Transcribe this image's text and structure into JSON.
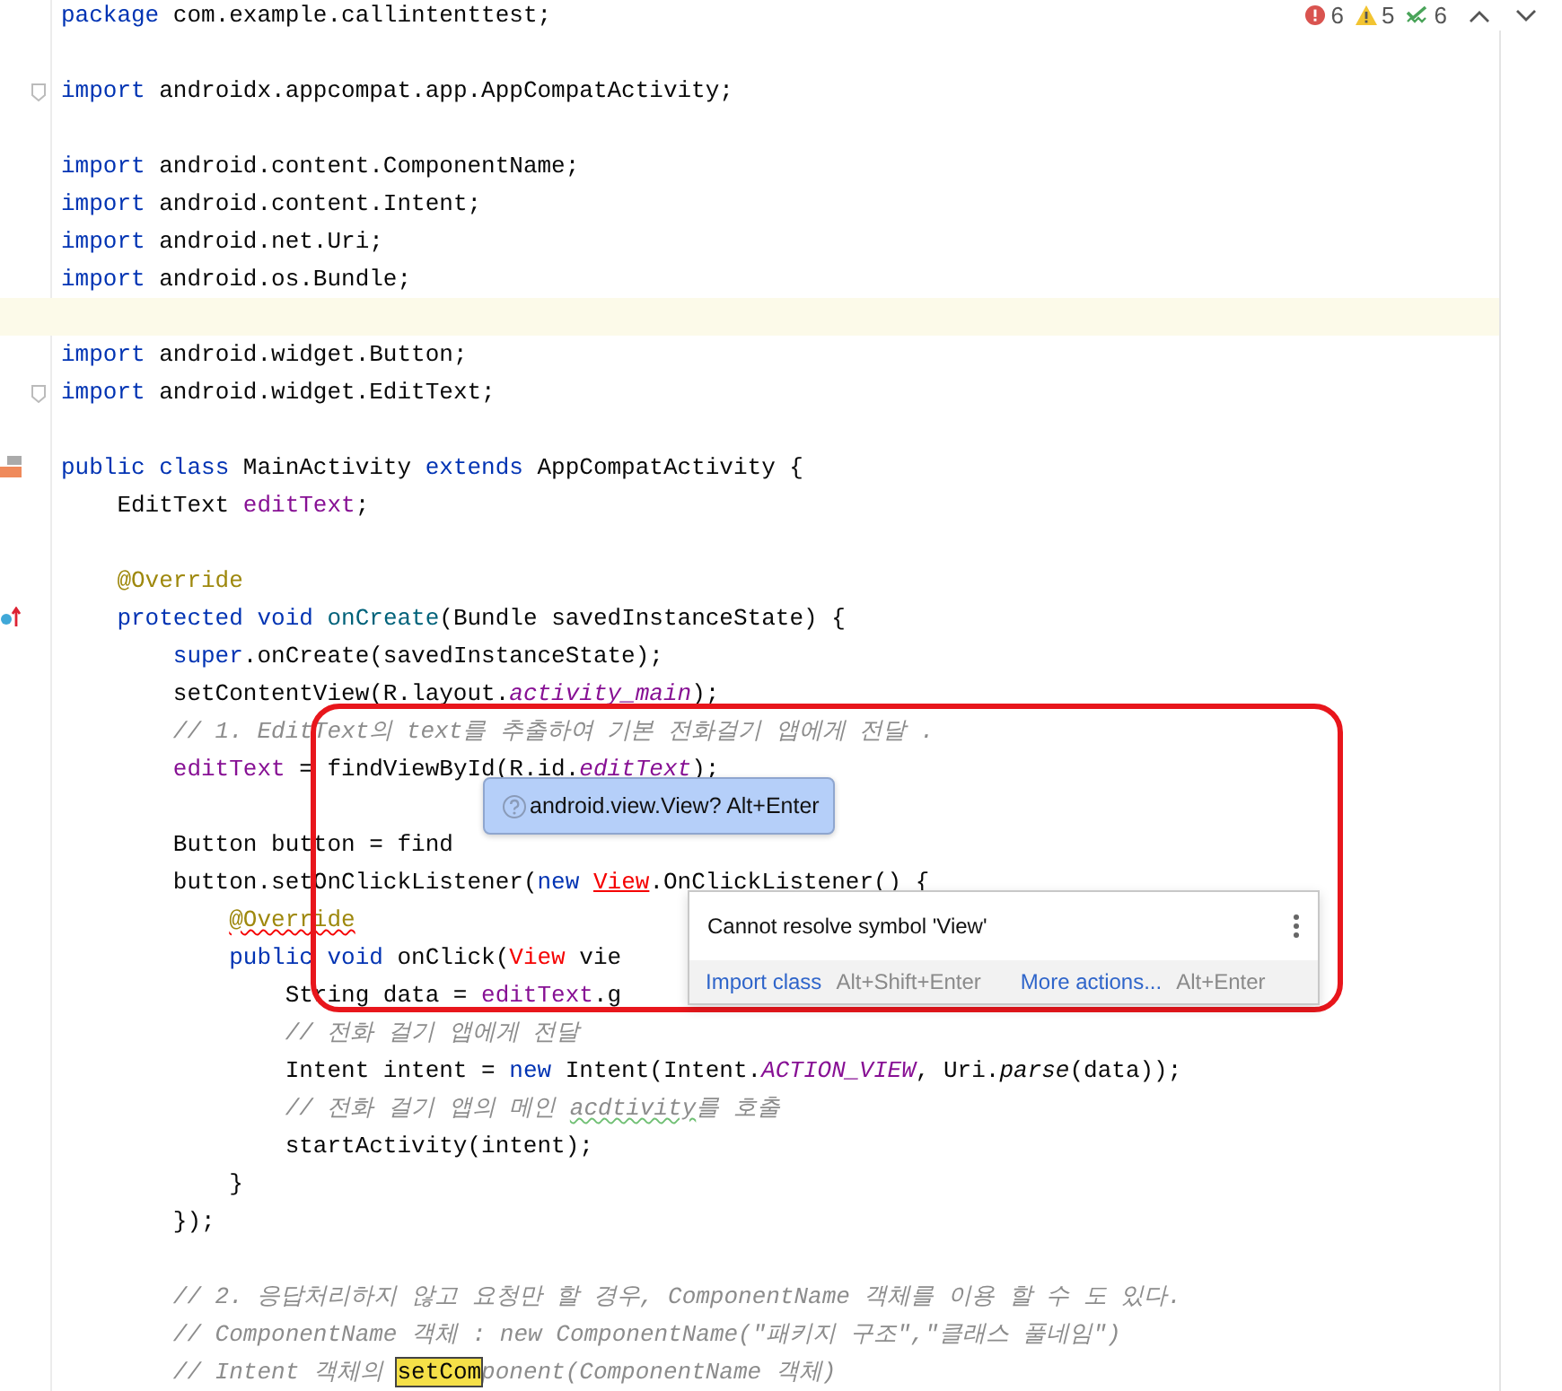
{
  "inspections": [
    {
      "kind": "error",
      "count": "6"
    },
    {
      "kind": "warning",
      "count": "5"
    },
    {
      "kind": "typo",
      "count": "6"
    }
  ],
  "lines": [
    {
      "current": false,
      "tokens": [
        {
          "kind": "kw",
          "text": "package"
        },
        {
          "kind": "plain",
          "text": " com.example.callintenttest;"
        }
      ]
    },
    {
      "current": false
    },
    {
      "kind": "fold",
      "current": false,
      "tokens": [
        {
          "kind": "kw",
          "text": "import"
        },
        {
          "kind": "plain",
          "text": " androidx.appcompat.app.AppCompatActivity;"
        }
      ]
    },
    {
      "current": false
    },
    {
      "current": false,
      "tokens": [
        {
          "kind": "kw",
          "text": "import"
        },
        {
          "kind": "plain",
          "text": " android.content.ComponentName;"
        }
      ]
    },
    {
      "current": false,
      "tokens": [
        {
          "kind": "kw",
          "text": "import"
        },
        {
          "kind": "plain",
          "text": " android.content.Intent;"
        }
      ]
    },
    {
      "current": false,
      "tokens": [
        {
          "kind": "kw",
          "text": "import"
        },
        {
          "kind": "plain",
          "text": " android.net.Uri;"
        }
      ]
    },
    {
      "current": false,
      "tokens": [
        {
          "kind": "kw",
          "text": "import"
        },
        {
          "kind": "plain",
          "text": " android.os.Bundle;"
        }
      ]
    },
    {
      "current": true
    },
    {
      "current": false,
      "tokens": [
        {
          "kind": "kw",
          "text": "import"
        },
        {
          "kind": "plain",
          "text": " android.widget.Button;"
        }
      ]
    },
    {
      "kind": "fold",
      "current": false,
      "tokens": [
        {
          "kind": "kw",
          "text": "import"
        },
        {
          "kind": "plain",
          "text": " android.widget.EditText;"
        }
      ]
    },
    {
      "current": false
    },
    {
      "kind": "class",
      "current": false,
      "tokens": [
        {
          "kind": "kw",
          "text": "public class"
        },
        {
          "kind": "plain",
          "text": " MainActivity "
        },
        {
          "kind": "kw",
          "text": "extends"
        },
        {
          "kind": "plain",
          "text": " AppCompatActivity {"
        }
      ],
      "children": [
        {
          "current": false,
          "tokens": [
            {
              "kind": "plain",
              "text": "EditText "
            },
            {
              "kind": "field",
              "text": "editText"
            },
            {
              "kind": "plain",
              "text": ";"
            }
          ]
        },
        {
          "current": false
        },
        {
          "current": false,
          "tokens": [
            {
              "kind": "ann",
              "text": "@Override"
            }
          ]
        },
        {
          "kind": "override",
          "current": false,
          "tokens": [
            {
              "kind": "kw",
              "text": "protected void "
            },
            {
              "kind": "method",
              "text": "onCreate"
            },
            {
              "kind": "plain",
              "text": "(Bundle savedInstanceState) {"
            }
          ],
          "children": [
            {
              "current": false,
              "tokens": [
                {
                  "kind": "kw",
                  "text": "super"
                },
                {
                  "kind": "plain",
                  "text": ".onCreate(savedInstanceState);"
                }
              ]
            },
            {
              "current": false,
              "tokens": [
                {
                  "kind": "plain",
                  "text": "setContentView(R.layout."
                },
                {
                  "kind": "sfield",
                  "text": "activity_main"
                },
                {
                  "kind": "plain",
                  "text": ");"
                }
              ]
            },
            {
              "current": false,
              "tokens": [
                {
                  "kind": "cmt",
                  "text": "// 1. EditText의 text를 추출하여 기본 전화걸기 앱에게 전달 ."
                }
              ]
            },
            {
              "current": false,
              "tokens": [
                {
                  "kind": "field",
                  "text": "editText"
                },
                {
                  "kind": "plain",
                  "text": " = findViewById(R.id."
                },
                {
                  "kind": "sfield",
                  "text": "editText"
                },
                {
                  "kind": "plain",
                  "text": ");"
                }
              ]
            },
            {
              "current": false
            },
            {
              "current": false,
              "tokens": [
                {
                  "kind": "plain",
                  "text": "Button button = find"
                }
              ]
            },
            {
              "current": false,
              "tokens": [
                {
                  "kind": "plain",
                  "text": "button.setOnClickListener("
                },
                {
                  "kind": "kw",
                  "text": "new "
                },
                {
                  "kind": "err",
                  "text": "View"
                },
                {
                  "kind": "plain",
                  "text": ".OnClickListener() {"
                }
              ],
              "children": [
                {
                  "current": false,
                  "tokens": [
                    {
                      "kind": "annerr",
                      "text": "@Override"
                    }
                  ]
                },
                {
                  "current": false,
                  "tokens": [
                    {
                      "kind": "kw",
                      "text": "public void "
                    },
                    {
                      "kind": "plain",
                      "text": "onClick("
                    },
                    {
                      "kind": "errtext",
                      "text": "View"
                    },
                    {
                      "kind": "plain",
                      "text": " vie"
                    }
                  ],
                  "children": [
                    {
                      "current": false,
                      "tokens": [
                        {
                          "kind": "plain",
                          "text": "String data = "
                        },
                        {
                          "kind": "field",
                          "text": "editText"
                        },
                        {
                          "kind": "plain",
                          "text": ".g"
                        }
                      ]
                    },
                    {
                      "current": false,
                      "tokens": [
                        {
                          "kind": "cmt",
                          "text": "// 전화 걸기 앱에게 전달"
                        }
                      ]
                    },
                    {
                      "current": false,
                      "tokens": [
                        {
                          "kind": "plain",
                          "text": "Intent intent = "
                        },
                        {
                          "kind": "kw",
                          "text": "new"
                        },
                        {
                          "kind": "plain",
                          "text": " Intent(Intent."
                        },
                        {
                          "kind": "sfield",
                          "text": "ACTION_VIEW"
                        },
                        {
                          "kind": "plain",
                          "text": ", Uri."
                        },
                        {
                          "kind": "italic",
                          "text": "parse"
                        },
                        {
                          "kind": "plain",
                          "text": "(data));"
                        }
                      ]
                    },
                    {
                      "current": false,
                      "tokens": [
                        {
                          "kind": "cmt",
                          "text": "// 전화 걸기 앱의 메인 "
                        },
                        {
                          "kind": "typo",
                          "text": "acdtivity"
                        },
                        {
                          "kind": "cmt",
                          "text": "를 호출"
                        }
                      ]
                    },
                    {
                      "current": false,
                      "tokens": [
                        {
                          "kind": "plain",
                          "text": "startActivity(intent);"
                        }
                      ]
                    }
                  ]
                },
                {
                  "current": false,
                  "tokens": [
                    {
                      "kind": "plain",
                      "text": "}"
                    }
                  ]
                }
              ]
            },
            {
              "current": false,
              "tokens": [
                {
                  "kind": "plain",
                  "text": "});"
                }
              ]
            },
            {
              "current": false
            },
            {
              "current": false,
              "tokens": [
                {
                  "kind": "cmt",
                  "text": "// 2. 응답처리하지 않고 요청만 할 경우, ComponentName 객체를 이용 할 수 도 있다."
                }
              ]
            },
            {
              "current": false,
              "tokens": [
                {
                  "kind": "cmt",
                  "text": "// ComponentName 객체 : new ComponentName(\"패키지 구조\",\"클래스 풀네임\")"
                }
              ]
            },
            {
              "current": false,
              "tokens": [
                {
                  "kind": "cmt",
                  "text": "// Intent 객체의 "
                },
                {
                  "kind": "hl",
                  "text": "setCom"
                },
                {
                  "kind": "cmt",
                  "text": "ponent(ComponentName 객체)"
                }
              ]
            }
          ]
        }
      ]
    }
  ],
  "tooltip": {
    "text": "android.view.View? Alt+Enter"
  },
  "error_popup": {
    "message": "Cannot resolve symbol 'View'",
    "actions": [
      {
        "label": "Import class",
        "shortcut": "Alt+Shift+Enter"
      },
      {
        "label": "More actions...",
        "shortcut": "Alt+Enter"
      }
    ]
  }
}
